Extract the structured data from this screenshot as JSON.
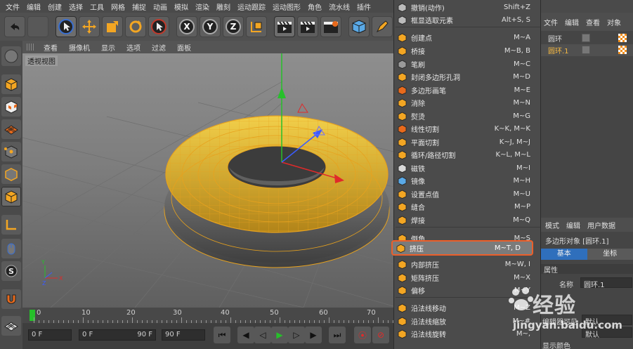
{
  "menubar": [
    "文件",
    "编辑",
    "创建",
    "选择",
    "工具",
    "网格",
    "捕捉",
    "动画",
    "模拟",
    "渲染",
    "雕刻",
    "运动跟踪",
    "运动图形",
    "角色",
    "流水线",
    "插件"
  ],
  "toolbar": {
    "axis_x": "X",
    "axis_y": "Y",
    "axis_z": "Z"
  },
  "viewport": {
    "menu": [
      "查看",
      "摄像机",
      "显示",
      "选项",
      "过滤",
      "面板"
    ],
    "label": "透视视图"
  },
  "timeline": {
    "ticks": [
      "0",
      "10",
      "20",
      "30",
      "40",
      "50",
      "60",
      "70"
    ],
    "current_frame": "0 F",
    "start_frame": "0 F",
    "end_frame_inner": "90 F",
    "end_frame": "90 F"
  },
  "context_menu": {
    "items": [
      {
        "label": "撤销(动作)",
        "shortcut": "Shift+Z"
      },
      {
        "label": "框显选取元素",
        "shortcut": "Alt+S, S"
      },
      {
        "label": "创建点",
        "shortcut": "M~A"
      },
      {
        "label": "桥接",
        "shortcut": "M~B, B"
      },
      {
        "label": "笔刷",
        "shortcut": "M~C"
      },
      {
        "label": "封闭多边形孔洞",
        "shortcut": "M~D"
      },
      {
        "label": "多边形画笔",
        "shortcut": "M~E"
      },
      {
        "label": "消除",
        "shortcut": "M~N"
      },
      {
        "label": "熨烫",
        "shortcut": "M~G"
      },
      {
        "label": "线性切割",
        "shortcut": "K~K, M~K"
      },
      {
        "label": "平面切割",
        "shortcut": "K~J, M~J"
      },
      {
        "label": "循环/路径切割",
        "shortcut": "K~L, M~L"
      },
      {
        "label": "磁铁",
        "shortcut": "M~I"
      },
      {
        "label": "镜像",
        "shortcut": "M~H"
      },
      {
        "label": "设置点值",
        "shortcut": "M~U"
      },
      {
        "label": "缝合",
        "shortcut": "M~P"
      },
      {
        "label": "焊接",
        "shortcut": "M~Q"
      },
      {
        "label": "倒角",
        "shortcut": "M~S"
      },
      {
        "label": "挤压",
        "shortcut": "M~T, D"
      },
      {
        "label": "内部挤压",
        "shortcut": "M~W, I"
      },
      {
        "label": "矩阵挤压",
        "shortcut": "M~X"
      },
      {
        "label": "偏移",
        "shortcut": "M~Y"
      },
      {
        "label": "沿法线移动",
        "shortcut": "M~Z"
      },
      {
        "label": "沿法线缩放",
        "shortcut": "M~#"
      },
      {
        "label": "沿法线旋转",
        "shortcut": "M~,"
      }
    ]
  },
  "object_manager": {
    "menu": [
      "文件",
      "编辑",
      "查看",
      "对象"
    ],
    "objects": [
      {
        "name": "圆环",
        "color": "#d8d8d8"
      },
      {
        "name": "圆环.1",
        "color": "#f5b942"
      }
    ]
  },
  "attribute_manager": {
    "menu": [
      "模式",
      "编辑",
      "用户数据"
    ],
    "title": "多边形对象 [圆环.1]",
    "tab_basic": "基本",
    "tab_coord": "坐标",
    "section": "属性",
    "name_label": "名称",
    "name_value": "圆环.1",
    "editor_visible_label": "编辑器可见",
    "editor_visible_value": "默认",
    "render_visible_value": "默认",
    "display_color_label": "显示颜色"
  },
  "watermark": {
    "text": "经验",
    "url": "jingyan.baidu.com"
  },
  "colors": {
    "accent_orange": "#ec5f2a",
    "selected_tab": "#2f6fbc",
    "torus": "#e8b832"
  }
}
